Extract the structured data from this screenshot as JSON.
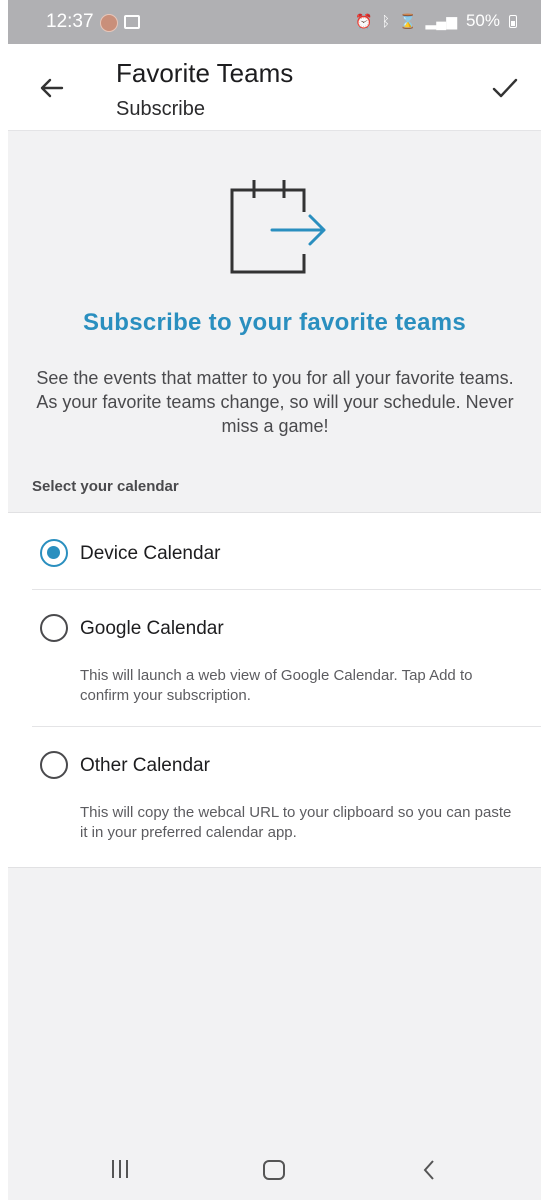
{
  "status_bar": {
    "time": "12:37",
    "battery": "50%"
  },
  "header": {
    "title": "Favorite Teams",
    "subtitle": "Subscribe"
  },
  "hero": {
    "icon": "calendar-export-icon",
    "title": "Subscribe to your favorite teams",
    "description": "See the events that matter to you for all your favorite teams. As your favorite teams change, so will your schedule. Never miss a game!"
  },
  "calendar_section": {
    "label": "Select your calendar",
    "options": [
      {
        "label": "Device Calendar",
        "description": "",
        "selected": true
      },
      {
        "label": "Google Calendar",
        "description": "This will launch a web view of Google Calendar. Tap Add to confirm your subscription.",
        "selected": false
      },
      {
        "label": "Other Calendar",
        "description": "This will copy the webcal URL to your clipboard so you can paste it in your preferred calendar app.",
        "selected": false
      }
    ]
  },
  "colors": {
    "accent": "#2a8fbf",
    "background": "#f2f2f3",
    "status_bar": "#b0b0b3"
  }
}
